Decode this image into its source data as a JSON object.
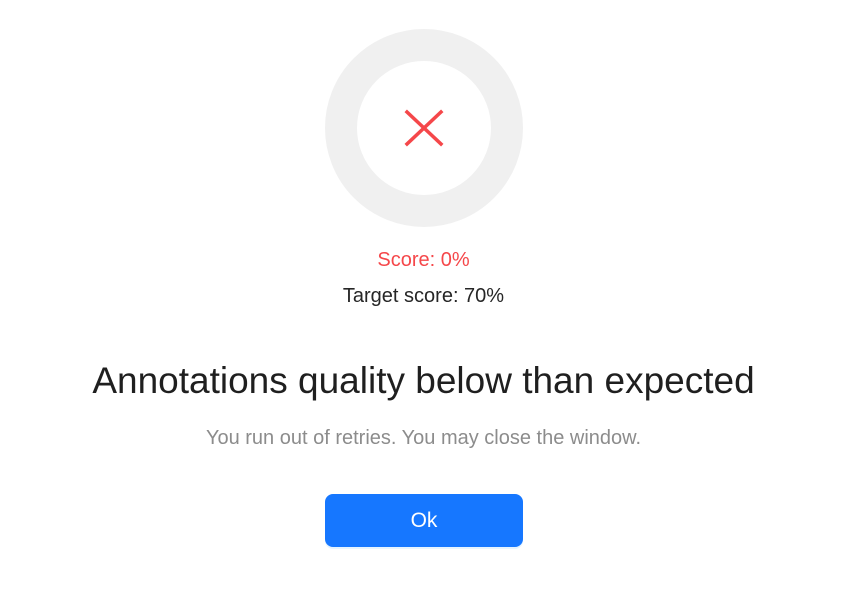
{
  "result": {
    "score_label": "Score: 0%",
    "score_value": 0,
    "target_label": "Target score: 70%",
    "status_icon": "close-icon",
    "ring_track_color": "#f0f0f0",
    "fail_color": "#f5474a"
  },
  "dialog": {
    "title": "Annotations quality below than expected",
    "message": "You run out of retries. You may close the window.",
    "ok_label": "Ok"
  },
  "colors": {
    "primary": "#1677ff",
    "text": "#1f1f1f",
    "muted": "#8c8c8c"
  }
}
